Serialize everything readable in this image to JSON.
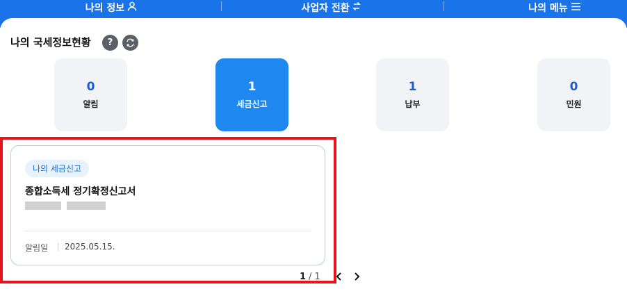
{
  "nav": {
    "items": [
      {
        "label": "나의 정보",
        "icon": "person-icon"
      },
      {
        "label": "사업자 전환",
        "icon": "switch-arrows-icon"
      },
      {
        "label": "나의 메뉴",
        "icon": "hamburger-menu-icon"
      }
    ]
  },
  "section": {
    "title": "나의 국세정보현황",
    "help_icon": "question-icon",
    "refresh_icon": "refresh-icon"
  },
  "tiles": [
    {
      "count": "0",
      "label": "알림",
      "active": false
    },
    {
      "count": "1",
      "label": "세금신고",
      "active": true
    },
    {
      "count": "1",
      "label": "납부",
      "active": false
    },
    {
      "count": "0",
      "label": "민원",
      "active": false
    }
  ],
  "card": {
    "tag": "나의 세금신고",
    "title": "종합소득세 정기확정신고서",
    "date_label": "알림일",
    "date_value": "2025.05.15."
  },
  "pagination": {
    "current": "1",
    "separator": "/",
    "total": "1",
    "prev_icon": "chevron-left-icon",
    "next_icon": "chevron-right-icon"
  },
  "colors": {
    "nav_blue": "#1a73e8",
    "active_tile": "#1e88f0",
    "highlight_red": "#e8141b"
  }
}
